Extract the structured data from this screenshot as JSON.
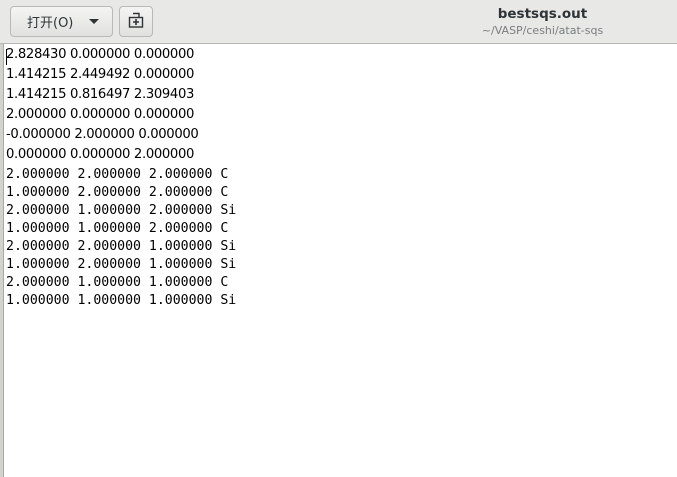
{
  "header": {
    "open_label": "打开(O)",
    "open_dropdown_icon": "chevron-down-icon",
    "new_document_icon": "new-document-icon",
    "title": "bestsqs.out",
    "subtitle": "~/VASP/ceshi/atat-sqs"
  },
  "document": {
    "lines": [
      "2.828430 0.000000 0.000000",
      "1.414215 2.449492 0.000000",
      "1.414215 0.816497 2.309403",
      "2.000000 0.000000 0.000000",
      "-0.000000 2.000000 0.000000",
      "0.000000 0.000000 2.000000",
      "2.000000 2.000000 2.000000 C",
      "1.000000 2.000000 2.000000 C",
      "2.000000 1.000000 2.000000 Si",
      "1.000000 1.000000 2.000000 C",
      "2.000000 2.000000 1.000000 Si",
      "1.000000 2.000000 1.000000 Si",
      "2.000000 1.000000 1.000000 C",
      "1.000000 1.000000 1.000000 Si"
    ]
  }
}
